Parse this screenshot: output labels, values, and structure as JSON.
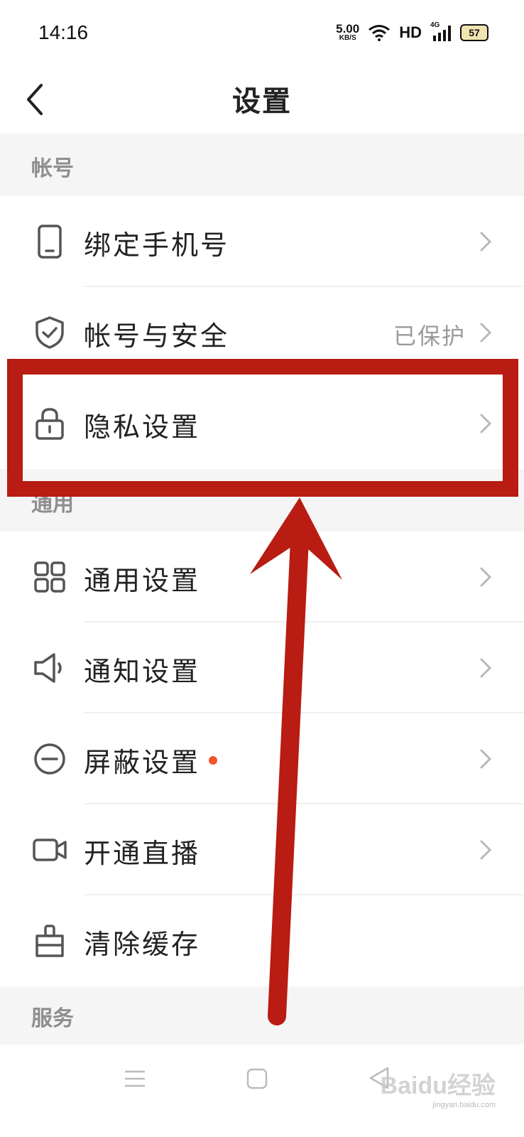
{
  "status_bar": {
    "time": "14:16",
    "net_speed_value": "5.00",
    "net_speed_unit": "KB/S",
    "hd_label": "HD",
    "network_label": "4G",
    "battery_level": "57"
  },
  "header": {
    "title": "设置"
  },
  "sections": {
    "account": {
      "label": "帐号",
      "items": [
        {
          "label": "绑定手机号",
          "icon": "phone-icon"
        },
        {
          "label": "帐号与安全",
          "value": "已保护",
          "icon": "shield-icon"
        },
        {
          "label": "隐私设置",
          "icon": "lock-icon"
        }
      ]
    },
    "general": {
      "label": "通用",
      "items": [
        {
          "label": "通用设置",
          "icon": "grid-icon"
        },
        {
          "label": "通知设置",
          "icon": "speaker-icon"
        },
        {
          "label": "屏蔽设置",
          "icon": "block-icon",
          "badge": "red-dot"
        },
        {
          "label": "开通直播",
          "icon": "video-camera-icon"
        },
        {
          "label": "清除缓存",
          "icon": "brush-icon"
        }
      ]
    },
    "service": {
      "label": "服务"
    }
  },
  "watermark": {
    "text": "Baidu经验",
    "url": "jingyan.baidu.com"
  },
  "colors": {
    "annotation_red": "#b81c12",
    "section_bg": "#f5f5f5",
    "badge_orange": "#f0562a"
  }
}
